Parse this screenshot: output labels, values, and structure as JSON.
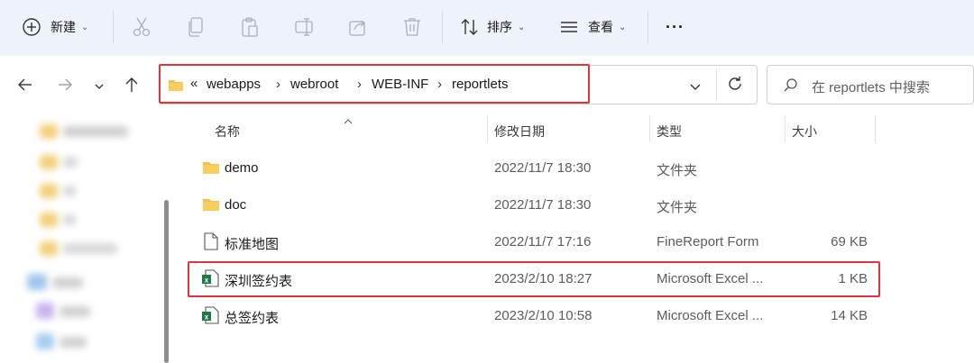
{
  "toolbar": {
    "new_label": "新建",
    "sort_label": "排序",
    "view_label": "查看",
    "more_label": "···"
  },
  "breadcrumb": {
    "overflow": "«",
    "items": [
      "webapps",
      "webroot",
      "WEB-INF",
      "reportlets"
    ],
    "separator": "›"
  },
  "search": {
    "placeholder": "在 reportlets 中搜索"
  },
  "columns": {
    "name": "名称",
    "modified": "修改日期",
    "type": "类型",
    "size": "大小"
  },
  "files": [
    {
      "name": "demo",
      "modified": "2022/11/7 18:30",
      "type": "文件夹",
      "size": "",
      "icon": "folder-icon"
    },
    {
      "name": "doc",
      "modified": "2022/11/7 18:30",
      "type": "文件夹",
      "size": "",
      "icon": "folder-icon"
    },
    {
      "name": "标准地图",
      "modified": "2022/11/7 17:16",
      "type": "FineReport Form",
      "size": "69 KB",
      "icon": "file-icon"
    },
    {
      "name": "深圳签约表",
      "modified": "2023/2/10 18:27",
      "type": "Microsoft Excel ...",
      "size": "1 KB",
      "icon": "excel-icon"
    },
    {
      "name": "总签约表",
      "modified": "2023/2/10 10:58",
      "type": "Microsoft Excel ...",
      "size": "14 KB",
      "icon": "excel-icon"
    }
  ],
  "colors": {
    "toolbar_bg": "#eef3f9",
    "highlight": "#e0353b",
    "folder": "#f4c14a",
    "excel": "#1f7a44"
  }
}
